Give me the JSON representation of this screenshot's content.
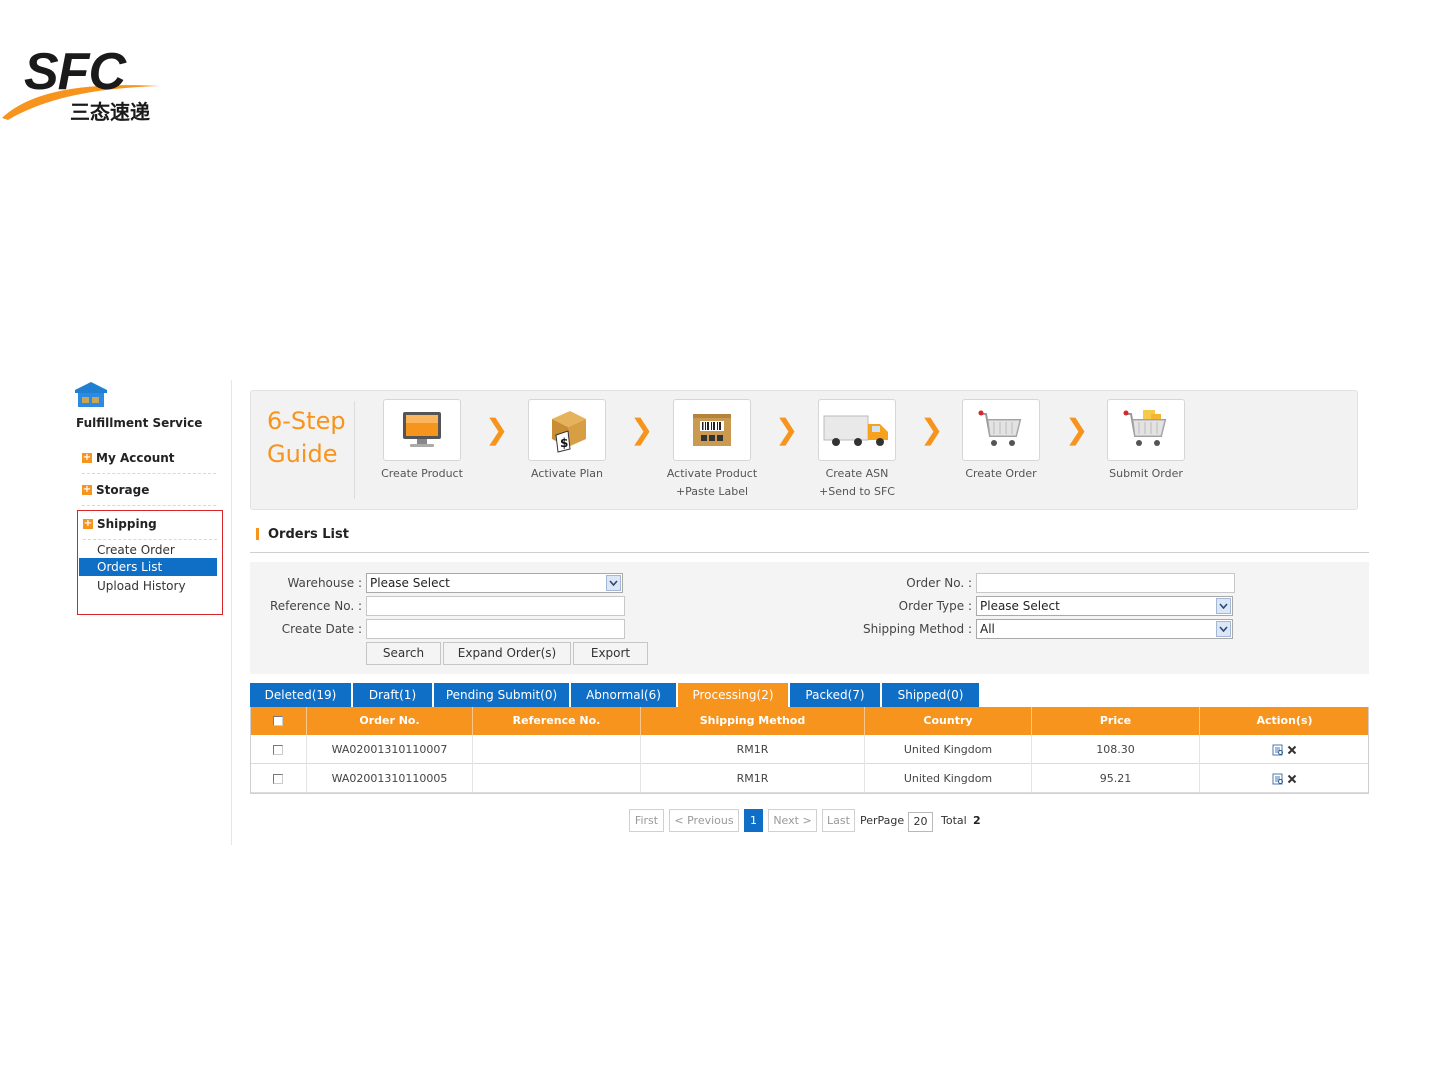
{
  "logo": {
    "brand": "SFC",
    "sub": "三态速递"
  },
  "sidebar": {
    "title": "Fulfillment Service",
    "sections": [
      {
        "label": "My Account"
      },
      {
        "label": "Storage"
      }
    ],
    "shipping": {
      "label": "Shipping",
      "items": [
        {
          "label": "Create Order"
        },
        {
          "label": "Orders List",
          "active": true
        },
        {
          "label": "Upload History"
        }
      ]
    }
  },
  "guide": {
    "title_line1": "6-Step",
    "title_line2": "Guide",
    "steps": [
      {
        "label1": "Create Product",
        "label2": "",
        "icon": "monitor-icon"
      },
      {
        "label1": "Activate Plan",
        "label2": "",
        "icon": "box-dollar-icon"
      },
      {
        "label1": "Activate Product",
        "label2": "+Paste Label",
        "icon": "barcode-box-icon"
      },
      {
        "label1": "Create ASN",
        "label2": "+Send to SFC",
        "icon": "truck-icon"
      },
      {
        "label1": "Create Order",
        "label2": "",
        "icon": "cart-icon"
      },
      {
        "label1": "Submit Order",
        "label2": "",
        "icon": "cart-full-icon"
      }
    ],
    "arrow": "❯"
  },
  "orders": {
    "title": "Orders List",
    "filters": {
      "warehouse_label": "Warehouse :",
      "warehouse_value": "Please Select",
      "reference_label": "Reference No. :",
      "reference_value": "",
      "create_date_label": "Create Date :",
      "create_date_value": "",
      "order_no_label": "Order No. :",
      "order_no_value": "",
      "order_type_label": "Order Type :",
      "order_type_value": "Please Select",
      "shipping_method_label": "Shipping Method :",
      "shipping_method_value": "All"
    },
    "buttons": {
      "search": "Search",
      "expand": "Expand Order(s)",
      "export": "Export"
    },
    "tabs": [
      {
        "label": "Deleted(19)"
      },
      {
        "label": "Draft(1)"
      },
      {
        "label": "Pending Submit(0)"
      },
      {
        "label": "Abnormal(6)"
      },
      {
        "label": "Processing(2)",
        "active": true
      },
      {
        "label": "Packed(7)"
      },
      {
        "label": "Shipped(0)"
      }
    ],
    "columns": [
      "Order No.",
      "Reference No.",
      "Shipping Method",
      "Country",
      "Price",
      "Action(s)"
    ],
    "rows": [
      {
        "order_no": "WA02001310110007",
        "reference_no": "",
        "shipping_method": "RM1R",
        "country": "United Kingdom",
        "price": "108.30"
      },
      {
        "order_no": "WA02001310110005",
        "reference_no": "",
        "shipping_method": "RM1R",
        "country": "United Kingdom",
        "price": "95.21"
      }
    ],
    "pagination": {
      "first": "First",
      "previous": "< Previous",
      "current": "1",
      "next": "Next >",
      "last": "Last",
      "per_page_label": "PerPage",
      "per_page_value": "20",
      "total_label": "Total",
      "total_value": "2"
    }
  },
  "colors": {
    "accent": "#f7941d",
    "primary": "#0f6fc6",
    "highlight_border": "#d9252a"
  }
}
